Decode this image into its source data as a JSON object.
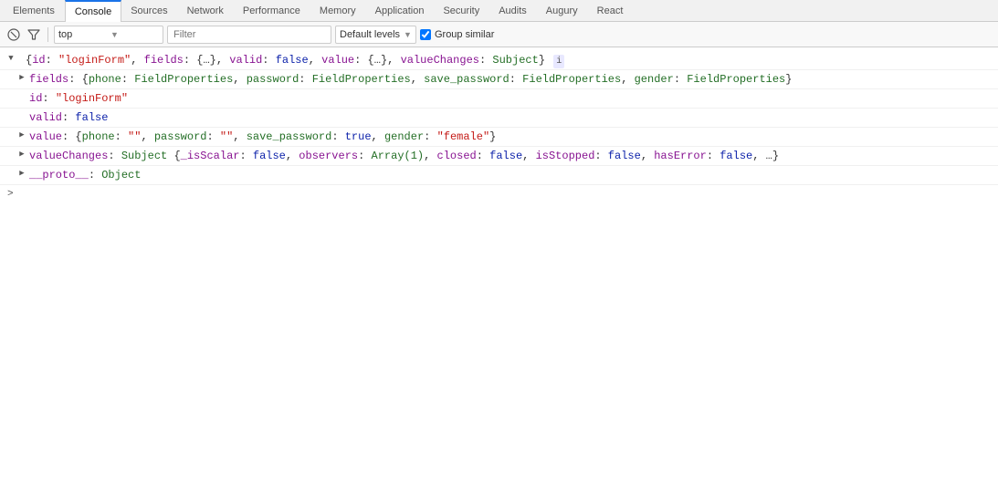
{
  "tabs": {
    "items": [
      {
        "label": "Elements",
        "active": false
      },
      {
        "label": "Console",
        "active": true
      },
      {
        "label": "Sources",
        "active": false
      },
      {
        "label": "Network",
        "active": false
      },
      {
        "label": "Performance",
        "active": false
      },
      {
        "label": "Memory",
        "active": false
      },
      {
        "label": "Application",
        "active": false
      },
      {
        "label": "Security",
        "active": false
      },
      {
        "label": "Audits",
        "active": false
      },
      {
        "label": "Augury",
        "active": false
      },
      {
        "label": "React",
        "active": false
      }
    ]
  },
  "toolbar": {
    "context_value": "top",
    "filter_placeholder": "Filter",
    "levels_label": "Default levels",
    "group_similar_label": "Group similar",
    "group_similar_checked": true
  },
  "console": {
    "main_object": {
      "summary": "▼ {id: \"loginForm\", fields: {…}, valid: false, value: {…}, valueChanges: Subject}",
      "badge": "i",
      "fields_line": "▶ fields: {phone: FieldProperties, password: FieldProperties, save_password: FieldProperties, gender: FieldProperties}",
      "id_line": "id: \"loginForm\"",
      "valid_line": "valid: false",
      "value_line": "▶ value: {phone: \"\", password: \"\", save_password: true, gender: \"female\"}",
      "value_changes_line": "▶ valueChanges: Subject {_isScalar: false, observers: Array(1), closed: false, isStopped: false, hasError: false, …}",
      "proto_line": "▶ __proto__: Object"
    }
  }
}
